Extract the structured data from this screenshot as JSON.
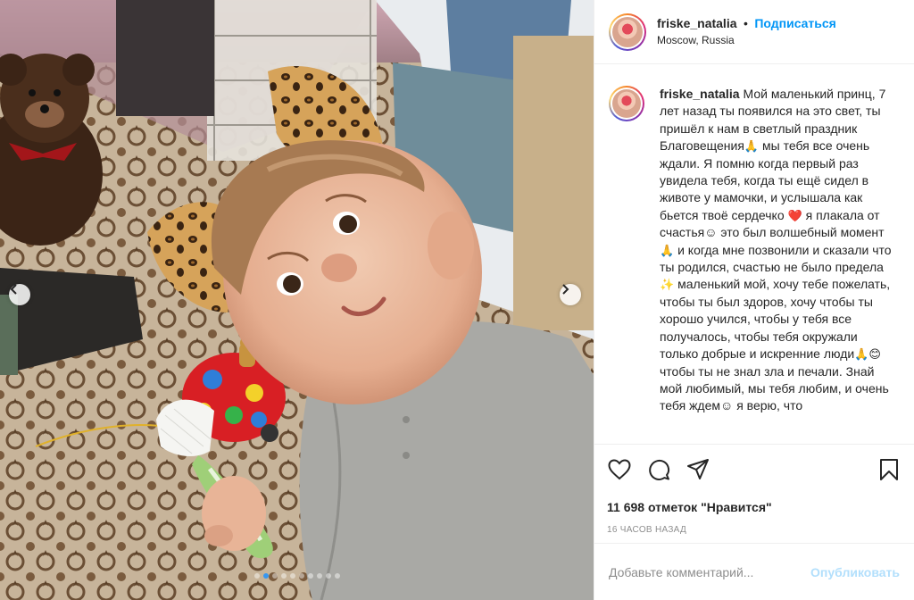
{
  "post": {
    "username": "friske_natalia",
    "separator": "•",
    "follow_label": "Подписаться",
    "location": "Moscow, Russia"
  },
  "caption": {
    "username": "friske_natalia",
    "part1": "Мой маленький принц, 7 лет назад ты появился на это свет, ты пришёл к нам в светлый праздник Благовещения",
    "part2": " мы тебя все очень ждали. Я помню когда первый раз увидела тебя, когда ты ещё сидел в животе у мамочки, и услышала как бьется твоё сердечко ",
    "part3": " я плакала от счастья☺ это был волшебный момент",
    "part4": " и когда мне позвонили и сказали что ты родился, счастью не было предела",
    "part5": " маленький мой, хочу тебе пожелать, чтобы ты был здоров, хочу чтобы ты хорошо учился, чтобы у тебя все получалось, чтобы тебя окружали только добрые и искренние люди",
    "part6": " чтобы ты не знал зла и печали. Знай мой любимый, мы тебя любим, и очень тебя ждем☺ я верю, что"
  },
  "stats": {
    "likes": "11 698 отметок \"Нравится\"",
    "time": "16 часов назад"
  },
  "comment": {
    "placeholder": "Добавьте комментарий...",
    "post_label": "Опубликовать"
  },
  "icons": {
    "like": "heart-icon",
    "comment": "comment-bubble-icon",
    "share": "paper-plane-icon",
    "save": "bookmark-icon",
    "prev": "chevron-left-icon",
    "next": "chevron-right-icon",
    "pray": "🙏",
    "heart": "❤️",
    "sparkles": "✨",
    "smile": "😊"
  },
  "colors": {
    "link_blue": "#0095f6",
    "post_disabled": "#b2dffc",
    "active_dot": "#3897f0"
  },
  "carousel": {
    "dot_count": 10,
    "active_dot": 1
  }
}
